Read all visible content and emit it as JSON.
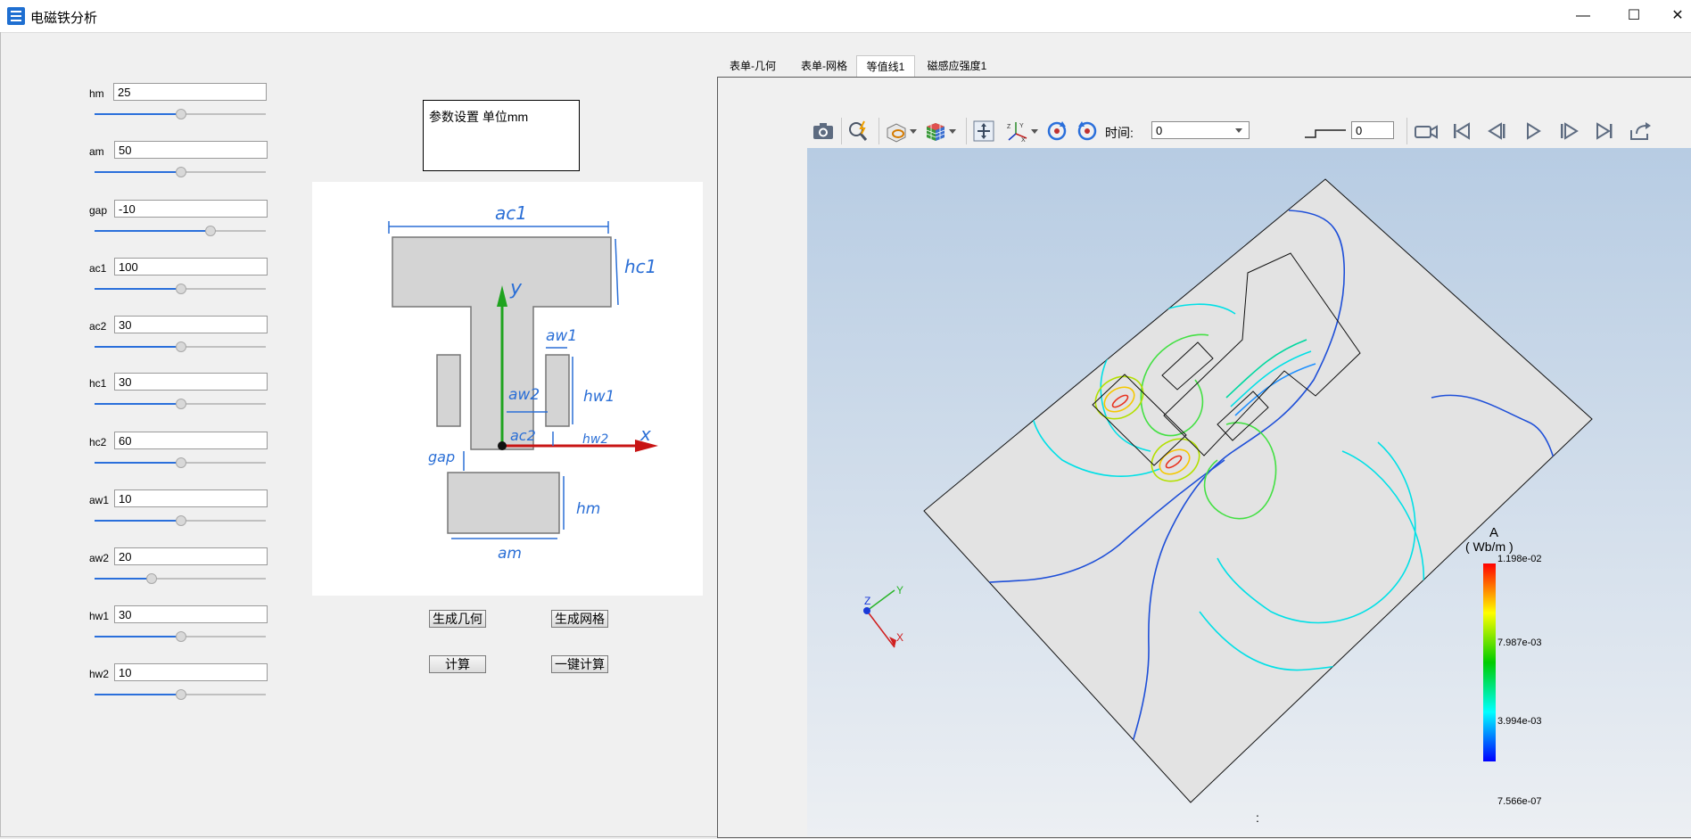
{
  "window": {
    "title": "电磁铁分析",
    "minimize": "—",
    "maximize": "☐",
    "close": "✕"
  },
  "params": [
    {
      "label": "hm",
      "value": "25",
      "slider": 0.5
    },
    {
      "label": "am",
      "value": "50",
      "slider": 0.5
    },
    {
      "label": "gap",
      "value": "-10",
      "slider": 0.67
    },
    {
      "label": "ac1",
      "value": "100",
      "slider": 0.5
    },
    {
      "label": "ac2",
      "value": "30",
      "slider": 0.5
    },
    {
      "label": "hc1",
      "value": "30",
      "slider": 0.5
    },
    {
      "label": "hc2",
      "value": "60",
      "slider": 0.5
    },
    {
      "label": "aw1",
      "value": "10",
      "slider": 0.5
    },
    {
      "label": "aw2",
      "value": "20",
      "slider": 0.33
    },
    {
      "label": "hw1",
      "value": "30",
      "slider": 0.5
    },
    {
      "label": "hw2",
      "value": "10",
      "slider": 0.5
    }
  ],
  "info": {
    "text": "参数设置  单位mm"
  },
  "diagram": {
    "ac1": "ac1",
    "hc1": "hc1",
    "aw1": "aw1",
    "aw2": "aw2",
    "hw1": "hw1",
    "ac2": "ac2",
    "hw2": "hw2",
    "gap": "gap",
    "hm": "hm",
    "am": "am",
    "y": "y",
    "x": "x"
  },
  "buttons": {
    "gen_geometry": "生成几何",
    "gen_mesh": "生成网格",
    "compute": "计算",
    "one_click": "一键计算"
  },
  "tabs": [
    {
      "label": "表单-几何",
      "active": false
    },
    {
      "label": "表单-网格",
      "active": false
    },
    {
      "label": "等值线1",
      "active": true
    },
    {
      "label": "磁感应强度1",
      "active": false
    }
  ],
  "toolbar": {
    "time_label": "时间:",
    "time_value": "0",
    "step_value": "0"
  },
  "legend": {
    "title": "A",
    "unit": "( Wb/m )",
    "ticks": [
      "1.198e-02",
      "7.987e-03",
      "3.994e-03",
      "7.566e-07"
    ],
    "colors": [
      "#ff0000",
      "#ffff00",
      "#00cc00",
      "#00ffff",
      "#0000ff"
    ]
  },
  "axes": {
    "z": "Z",
    "y": "Y",
    "x": "X"
  },
  "status": {
    "colon": ":"
  }
}
